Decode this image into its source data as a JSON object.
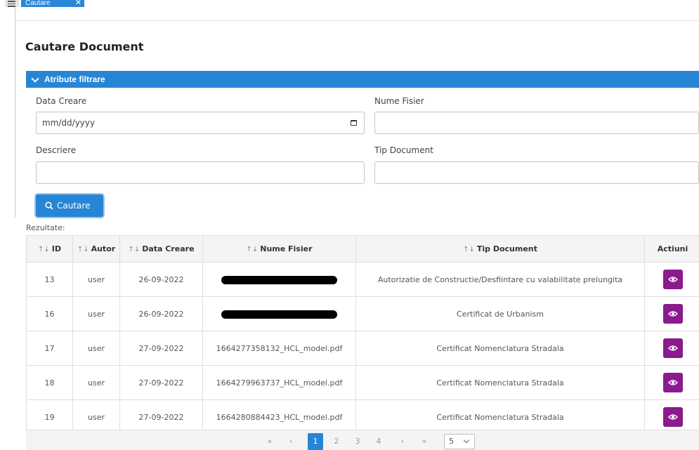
{
  "tabs": [
    {
      "label": "Cautare",
      "close": "✕"
    }
  ],
  "page": {
    "title": "Cautare Document"
  },
  "filter": {
    "panel_title": "Atribute filtrare",
    "fields": {
      "data_creare": {
        "label": "Data Creare",
        "placeholder": "mm/dd/yyyy"
      },
      "nume_fisier": {
        "label": "Nume Fisier",
        "value": ""
      },
      "descriere": {
        "label": "Descriere",
        "value": ""
      },
      "tip_document": {
        "label": "Tip Document",
        "value": ""
      }
    },
    "search_label": "Cautare"
  },
  "results": {
    "label": "Rezultate:",
    "sort_glyph": "↑↓",
    "columns": [
      "ID",
      "Autor",
      "Data Creare",
      "Nume Fisier",
      "Tip Document",
      "Actiuni"
    ],
    "rows": [
      {
        "id": "13",
        "autor": "user",
        "data": "26-09-2022",
        "fisier": "",
        "tip": "Autorizatie de Constructie/Desfiintare cu valabilitate prelungita"
      },
      {
        "id": "16",
        "autor": "user",
        "data": "26-09-2022",
        "fisier": "",
        "tip": "Certificat de Urbanism"
      },
      {
        "id": "17",
        "autor": "user",
        "data": "27-09-2022",
        "fisier": "1664277358132_HCL_model.pdf",
        "tip": "Certificat Nomenclatura Stradala"
      },
      {
        "id": "18",
        "autor": "user",
        "data": "27-09-2022",
        "fisier": "1664279963737_HCL_model.pdf",
        "tip": "Certificat Nomenclatura Stradala"
      },
      {
        "id": "19",
        "autor": "user",
        "data": "27-09-2022",
        "fisier": "1664280884423_HCL_model.pdf",
        "tip": "Certificat Nomenclatura Stradala"
      }
    ]
  },
  "pagination": {
    "first": "«",
    "prev": "‹",
    "pages": [
      "1",
      "2",
      "3",
      "4"
    ],
    "active_page": "1",
    "next": "›",
    "last": "»",
    "rows_per_page": "5"
  },
  "colors": {
    "primary": "#2785d6",
    "action": "#8a1a8e"
  }
}
